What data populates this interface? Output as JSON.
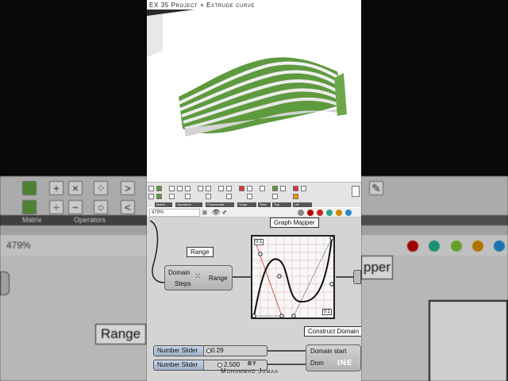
{
  "video": {
    "title": "EX 35 Project + Extrude curve"
  },
  "toolbar": {
    "categories": [
      "Matrix",
      "Operators",
      "Polynomials",
      "Script",
      "Time",
      "Trig",
      "Util"
    ]
  },
  "address_bar": {
    "zoom": "479%"
  },
  "components": {
    "range": {
      "tag": "Range",
      "inputs": [
        "Domain",
        "Steps"
      ],
      "output": "Range"
    },
    "graph_mapper": {
      "tag": "Graph Mapper",
      "corner_top": "0:1",
      "corner_bottom": "0:1"
    },
    "construct_domain": {
      "tag": "Construct Domain",
      "input_start": "Domain start",
      "input_end": "Dom"
    }
  },
  "sliders": [
    {
      "name": "Number Slider",
      "value": "0.29"
    },
    {
      "name": "Number Slider",
      "value": "2.500"
    }
  ],
  "watermark": {
    "by": "BY",
    "author": "Mohammad Jumaa",
    "brand": "INE"
  },
  "left_panel": {
    "category": "Matrix",
    "category2": "Operators",
    "zoom": "479%",
    "range_tag": "Range"
  },
  "right_panel": {
    "partial_label": "pper"
  }
}
